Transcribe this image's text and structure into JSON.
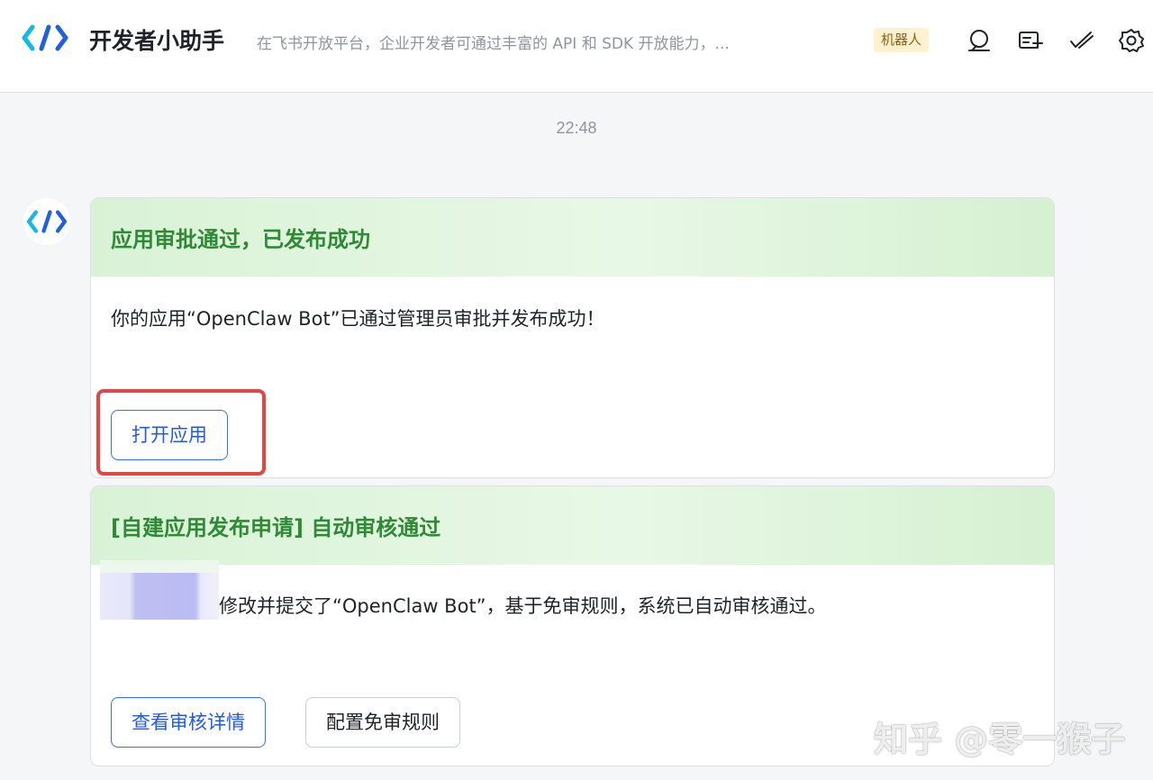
{
  "header": {
    "title": "开发者小助手",
    "description": "在飞书开放平台，企业开发者可通过丰富的 API 和 SDK 开放能力，...",
    "badge": "机器人",
    "icons": [
      "search-chat-icon",
      "new-message-icon",
      "edit-icon",
      "settings-icon"
    ]
  },
  "chat": {
    "timestamp": "22:48"
  },
  "cards": [
    {
      "title": "应用审批通过，已发布成功",
      "body": "你的应用“OpenClaw Bot”已通过管理员审批并发布成功！",
      "buttons": [
        {
          "label": "打开应用",
          "style": "primary"
        }
      ]
    },
    {
      "title": "[自建应用发布申请] 自动审核通过",
      "body": "修改并提交了“OpenClaw Bot”，基于免审规则，系统已自动审核通过。",
      "buttons": [
        {
          "label": "查看审核详情",
          "style": "primary"
        },
        {
          "label": "配置免审规则",
          "style": "default"
        }
      ]
    }
  ],
  "watermark": "知乎 @零一猴子",
  "colors": {
    "accent": "#3370ff",
    "card_title": "#2f8a35",
    "highlight": "#e54545",
    "badge_bg": "#fdf1cf",
    "badge_text": "#8f6210"
  }
}
